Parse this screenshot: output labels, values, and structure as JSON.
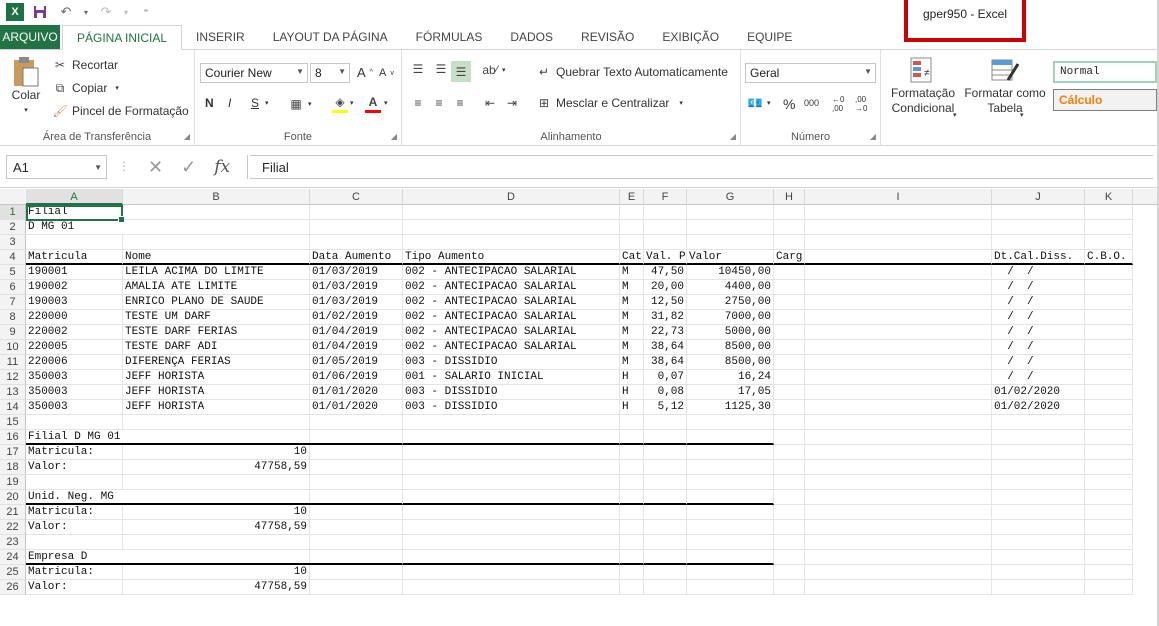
{
  "title": {
    "window_title": "gper950 - Excel"
  },
  "tabs": [
    "ARQUIVO",
    "PÁGINA INICIAL",
    "INSERIR",
    "LAYOUT DA PÁGINA",
    "FÓRMULAS",
    "DADOS",
    "REVISÃO",
    "EXIBIÇÃO",
    "EQUIPE"
  ],
  "ribbon": {
    "clipboard": {
      "label": "Área de Transferência",
      "paste": "Colar",
      "cut": "Recortar",
      "copy": "Copiar",
      "format_painter": "Pincel de Formatação"
    },
    "font": {
      "label": "Fonte",
      "font_name": "Courier New",
      "font_size": "8",
      "bold": "N",
      "italic": "I",
      "underline": "S"
    },
    "alignment": {
      "label": "Alinhamento",
      "wrap": "Quebrar Texto Automaticamente",
      "merge": "Mesclar e Centralizar"
    },
    "number": {
      "label": "Número",
      "format": "Geral",
      "percent": "%",
      "thousands": "000"
    },
    "styles": {
      "conditional_1": "Formatação",
      "conditional_2": "Condicional",
      "table_1": "Formatar como",
      "table_2": "Tabela",
      "normal": "Normal",
      "calc": "Cálculo"
    }
  },
  "formula_bar": {
    "name_box": "A1",
    "content": "Filial"
  },
  "columns": [
    "A",
    "B",
    "C",
    "D",
    "E",
    "F",
    "G",
    "H",
    "I",
    "J",
    "K"
  ],
  "rows": [
    {
      "n": "1",
      "cells": [
        "Filial",
        "",
        "",
        "",
        "",
        "",
        "",
        "",
        "",
        "",
        ""
      ]
    },
    {
      "n": "2",
      "cells": [
        "D MG 01",
        "",
        "",
        "",
        "",
        "",
        "",
        "",
        "",
        "",
        ""
      ]
    },
    {
      "n": "3",
      "cells": [
        "",
        "",
        "",
        "",
        "",
        "",
        "",
        "",
        "",
        "",
        ""
      ]
    },
    {
      "n": "4",
      "cells": [
        "Matricula",
        "Nome",
        "Data Aumento",
        "Tipo Aumento",
        "Cat",
        "Val. P",
        "Valor",
        "Carg",
        "",
        "Dt.Cal.Diss.",
        "C.B.O."
      ]
    },
    {
      "n": "5",
      "cells": [
        "190001",
        "LEILA ACIMA DO LIMITE",
        "01/03/2019",
        "002 - ANTECIPACAO SALARIAL",
        "M",
        "47,50",
        "10450,00",
        "",
        "",
        "  /  /",
        ""
      ]
    },
    {
      "n": "6",
      "cells": [
        "190002",
        "AMALIA ATE LIMITE",
        "01/03/2019",
        "002 - ANTECIPACAO SALARIAL",
        "M",
        "20,00",
        "4400,00",
        "",
        "",
        "  /  /",
        ""
      ]
    },
    {
      "n": "7",
      "cells": [
        "190003",
        "ENRICO PLANO DE SAUDE",
        "01/03/2019",
        "002 - ANTECIPACAO SALARIAL",
        "M",
        "12,50",
        "2750,00",
        "",
        "",
        "  /  /",
        ""
      ]
    },
    {
      "n": "8",
      "cells": [
        "220000",
        "TESTE UM DARF",
        "01/02/2019",
        "002 - ANTECIPACAO SALARIAL",
        "M",
        "31,82",
        "7000,00",
        "",
        "",
        "  /  /",
        ""
      ]
    },
    {
      "n": "9",
      "cells": [
        "220002",
        "TESTE DARF FERIAS",
        "01/04/2019",
        "002 - ANTECIPACAO SALARIAL",
        "M",
        "22,73",
        "5000,00",
        "",
        "",
        "  /  /",
        ""
      ]
    },
    {
      "n": "10",
      "cells": [
        "220005",
        "TESTE DARF ADI",
        "01/04/2019",
        "002 - ANTECIPACAO SALARIAL",
        "M",
        "38,64",
        "8500,00",
        "",
        "",
        "  /  /",
        ""
      ]
    },
    {
      "n": "11",
      "cells": [
        "220006",
        "DIFERENÇA FERIAS",
        "01/05/2019",
        "003 - DISSIDIO",
        "M",
        "38,64",
        "8500,00",
        "",
        "",
        "  /  /",
        ""
      ]
    },
    {
      "n": "12",
      "cells": [
        "350003",
        "JEFF HORISTA",
        "01/06/2019",
        "001 - SALARIO INICIAL",
        "H",
        "0,07",
        "16,24",
        "",
        "",
        "  /  /",
        ""
      ]
    },
    {
      "n": "13",
      "cells": [
        "350003",
        "JEFF HORISTA",
        "01/01/2020",
        "003 - DISSIDIO",
        "H",
        "0,08",
        "17,05",
        "",
        "",
        "01/02/2020",
        ""
      ]
    },
    {
      "n": "14",
      "cells": [
        "350003",
        "JEFF HORISTA",
        "01/01/2020",
        "003 - DISSIDIO",
        "H",
        "5,12",
        "1125,30",
        "",
        "",
        "01/02/2020",
        ""
      ]
    },
    {
      "n": "15",
      "cells": [
        "",
        "",
        "",
        "",
        "",
        "",
        "",
        "",
        "",
        "",
        ""
      ]
    },
    {
      "n": "16",
      "cells": [
        "Filial D MG 01",
        "",
        "",
        "",
        "",
        "",
        "",
        "",
        "",
        "",
        ""
      ]
    },
    {
      "n": "17",
      "cells": [
        "Matricula:",
        "10",
        "",
        "",
        "",
        "",
        "",
        "",
        "",
        "",
        ""
      ]
    },
    {
      "n": "18",
      "cells": [
        "Valor:",
        "47758,59",
        "",
        "",
        "",
        "",
        "",
        "",
        "",
        "",
        ""
      ]
    },
    {
      "n": "19",
      "cells": [
        "",
        "",
        "",
        "",
        "",
        "",
        "",
        "",
        "",
        "",
        ""
      ]
    },
    {
      "n": "20",
      "cells": [
        "Unid. Neg. MG",
        "",
        "",
        "",
        "",
        "",
        "",
        "",
        "",
        "",
        ""
      ]
    },
    {
      "n": "21",
      "cells": [
        "Matricula:",
        "10",
        "",
        "",
        "",
        "",
        "",
        "",
        "",
        "",
        ""
      ]
    },
    {
      "n": "22",
      "cells": [
        "Valor:",
        "47758,59",
        "",
        "",
        "",
        "",
        "",
        "",
        "",
        "",
        ""
      ]
    },
    {
      "n": "23",
      "cells": [
        "",
        "",
        "",
        "",
        "",
        "",
        "",
        "",
        "",
        "",
        ""
      ]
    },
    {
      "n": "24",
      "cells": [
        "Empresa D",
        "",
        "",
        "",
        "",
        "",
        "",
        "",
        "",
        "",
        ""
      ]
    },
    {
      "n": "25",
      "cells": [
        "Matricula:",
        "10",
        "",
        "",
        "",
        "",
        "",
        "",
        "",
        "",
        ""
      ]
    },
    {
      "n": "26",
      "cells": [
        "Valor:",
        "47758,59",
        "",
        "",
        "",
        "",
        "",
        "",
        "",
        "",
        ""
      ]
    }
  ]
}
